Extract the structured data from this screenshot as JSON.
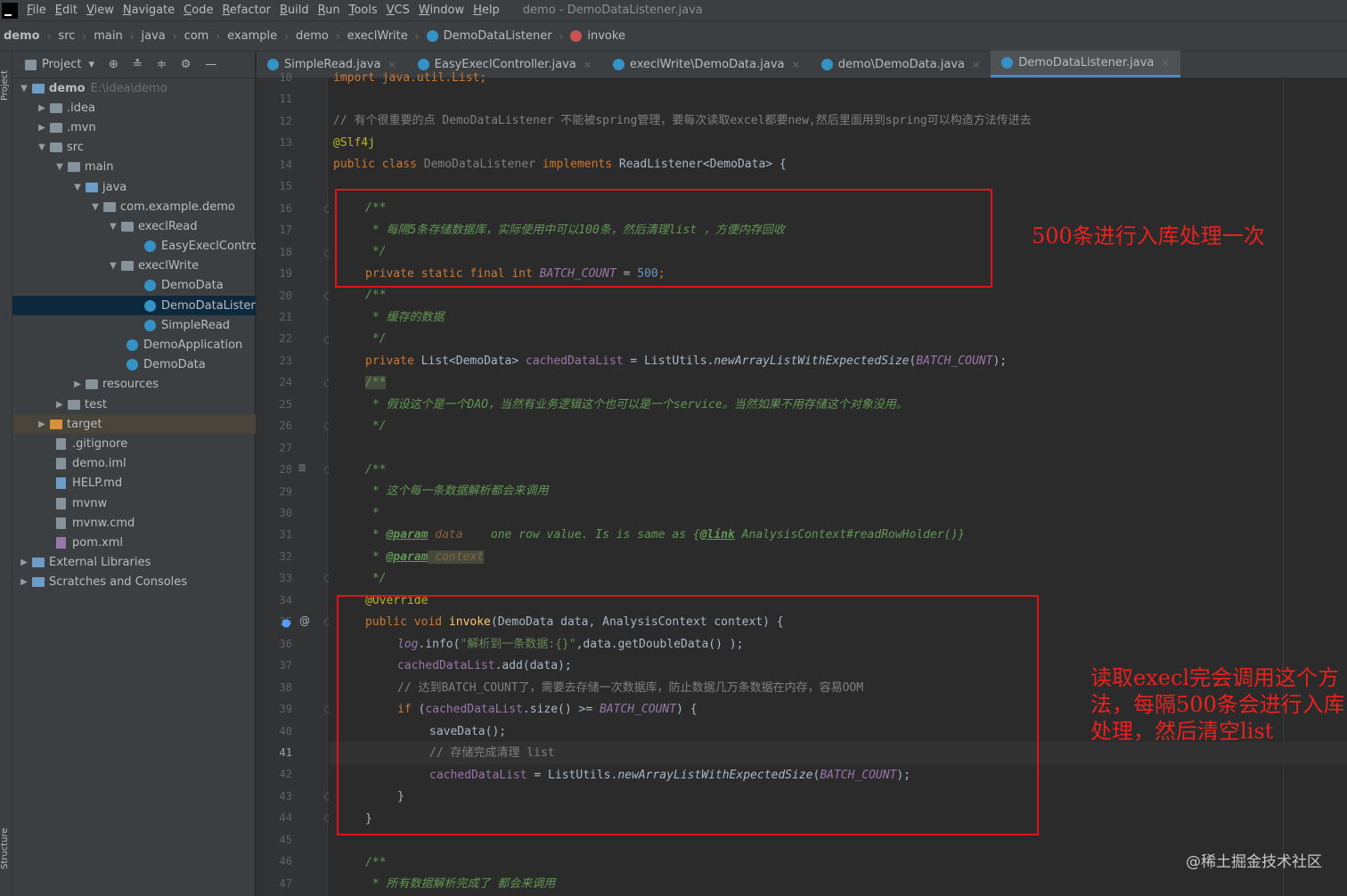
{
  "menubar": {
    "items": [
      "File",
      "Edit",
      "View",
      "Navigate",
      "Code",
      "Refactor",
      "Build",
      "Run",
      "Tools",
      "VCS",
      "Window",
      "Help"
    ],
    "title": "demo - DemoDataListener.java"
  },
  "breadcrumbs": [
    "demo",
    "src",
    "main",
    "java",
    "com",
    "example",
    "demo",
    "execlWrite",
    "DemoDataListener",
    "invoke"
  ],
  "toolstrip": {
    "project_label": "Project",
    "structure_label": "Structure"
  },
  "project_panel": {
    "title": "Project",
    "tree": [
      {
        "label": "demo",
        "path": "E:\\idea\\demo"
      },
      {
        "label": ".idea"
      },
      {
        "label": ".mvn"
      },
      {
        "label": "src"
      },
      {
        "label": "main"
      },
      {
        "label": "java"
      },
      {
        "label": "com.example.demo"
      },
      {
        "label": "execlRead"
      },
      {
        "label": "EasyExeclContro"
      },
      {
        "label": "execlWrite"
      },
      {
        "label": "DemoData"
      },
      {
        "label": "DemoDataListen"
      },
      {
        "label": "SimpleRead"
      },
      {
        "label": "DemoApplication"
      },
      {
        "label": "DemoData"
      },
      {
        "label": "resources"
      },
      {
        "label": "test"
      },
      {
        "label": "target"
      },
      {
        "label": ".gitignore"
      },
      {
        "label": "demo.iml"
      },
      {
        "label": "HELP.md"
      },
      {
        "label": "mvnw"
      },
      {
        "label": "mvnw.cmd"
      },
      {
        "label": "pom.xml"
      },
      {
        "label": "External Libraries"
      },
      {
        "label": "Scratches and Consoles"
      }
    ]
  },
  "tabs": [
    {
      "label": "SimpleRead.java"
    },
    {
      "label": "EasyExeclController.java"
    },
    {
      "label": "execlWrite\\DemoData.java"
    },
    {
      "label": "demo\\DemoData.java"
    },
    {
      "label": "DemoDataListener.java"
    }
  ],
  "line_numbers": [
    "10",
    "11",
    "12",
    "13",
    "14",
    "15",
    "16",
    "17",
    "18",
    "19",
    "20",
    "21",
    "22",
    "23",
    "24",
    "25",
    "26",
    "27",
    "28",
    "29",
    "30",
    "31",
    "32",
    "33",
    "34",
    "35",
    "36",
    "37",
    "38",
    "39",
    "40",
    "41",
    "42",
    "43",
    "44",
    "45",
    "46",
    "47"
  ],
  "code": {
    "l10": "import java.util.List;",
    "l12": "// 有个很重要的点 DemoDataListener 不能被spring管理，要每次读取excel都要new,然后里面用到spring可以构造方法传进去",
    "l13": "@Slf4j",
    "l14_a": "public class ",
    "l14_b": "DemoDataListener",
    "l14_c": " implements ",
    "l14_d": "ReadListener<DemoData> {",
    "l16": "/**",
    "l17": " * 每隔5条存储数据库，实际使用中可以100条，然后清理list ，方便内存回收",
    "l18": " */",
    "l19_a": "private static final int ",
    "l19_b": "BATCH_COUNT",
    "l19_c": " = ",
    "l19_d": "500",
    "l19_e": ";",
    "l20": "/**",
    "l21": " * 缓存的数据",
    "l22": " */",
    "l23_a": "private ",
    "l23_b": "List<DemoData> ",
    "l23_c": "cachedDataList",
    "l23_d": " = ListUtils.",
    "l23_e": "newArrayListWithExpectedSize",
    "l23_f": "(",
    "l23_g": "BATCH_COUNT",
    "l23_h": ");",
    "l24": "/**",
    "l25": " * 假设这个是一个DAO，当然有业务逻辑这个也可以是一个service。当然如果不用存储这个对象没用。",
    "l26": " */",
    "l28": "/**",
    "l29": " * 这个每一条数据解析都会来调用",
    "l30": " *",
    "l31_a": " * ",
    "l31_b": "@param",
    "l31_c": " data",
    "l31_d": "    one row value. Is is same as {",
    "l31_e": "@link",
    "l31_f": " AnalysisContext#readRowHolder()}",
    "l32_a": " * ",
    "l32_b": "@param",
    "l32_c": " context",
    "l33": " */",
    "l34": "@Override",
    "l35_a": "public void ",
    "l35_b": "invoke",
    "l35_c": "(DemoData data, AnalysisContext context) {",
    "l36_a": "log",
    "l36_b": ".info(",
    "l36_c": "\"解析到一条数据:{}\"",
    "l36_d": ",data.getDoubleData() );",
    "l37_a": "cachedDataList",
    "l37_b": ".add(data);",
    "l38": "// 达到BATCH_COUNT了，需要去存储一次数据库，防止数据几万条数据在内存，容易OOM",
    "l39_a": "if ",
    "l39_b": "(",
    "l39_c": "cachedDataList",
    "l39_d": ".size() >= ",
    "l39_e": "BATCH_COUNT",
    "l39_f": ") {",
    "l40": "saveData();",
    "l41": "// 存储完成清理 list",
    "l42_a": "cachedDataList",
    "l42_b": " = ListUtils.",
    "l42_c": "newArrayListWithExpectedSize",
    "l42_d": "(",
    "l42_e": "BATCH_COUNT",
    "l42_f": ");",
    "l43": "}",
    "l44": "}",
    "l46": "/**",
    "l47": " * 所有数据解析完成了 都会来调用"
  },
  "annotations": {
    "note1": "500条进行入库处理一次",
    "note2_l1": "读取execl完会调用这个方",
    "note2_l2": "法，每隔500条会进行入库",
    "note2_l3": "处理，然后清空list"
  },
  "watermark": "@稀土掘金技术社区",
  "colors": {
    "annotation_red": "#e0121c",
    "tab_active_underline": "#4a88c7"
  }
}
